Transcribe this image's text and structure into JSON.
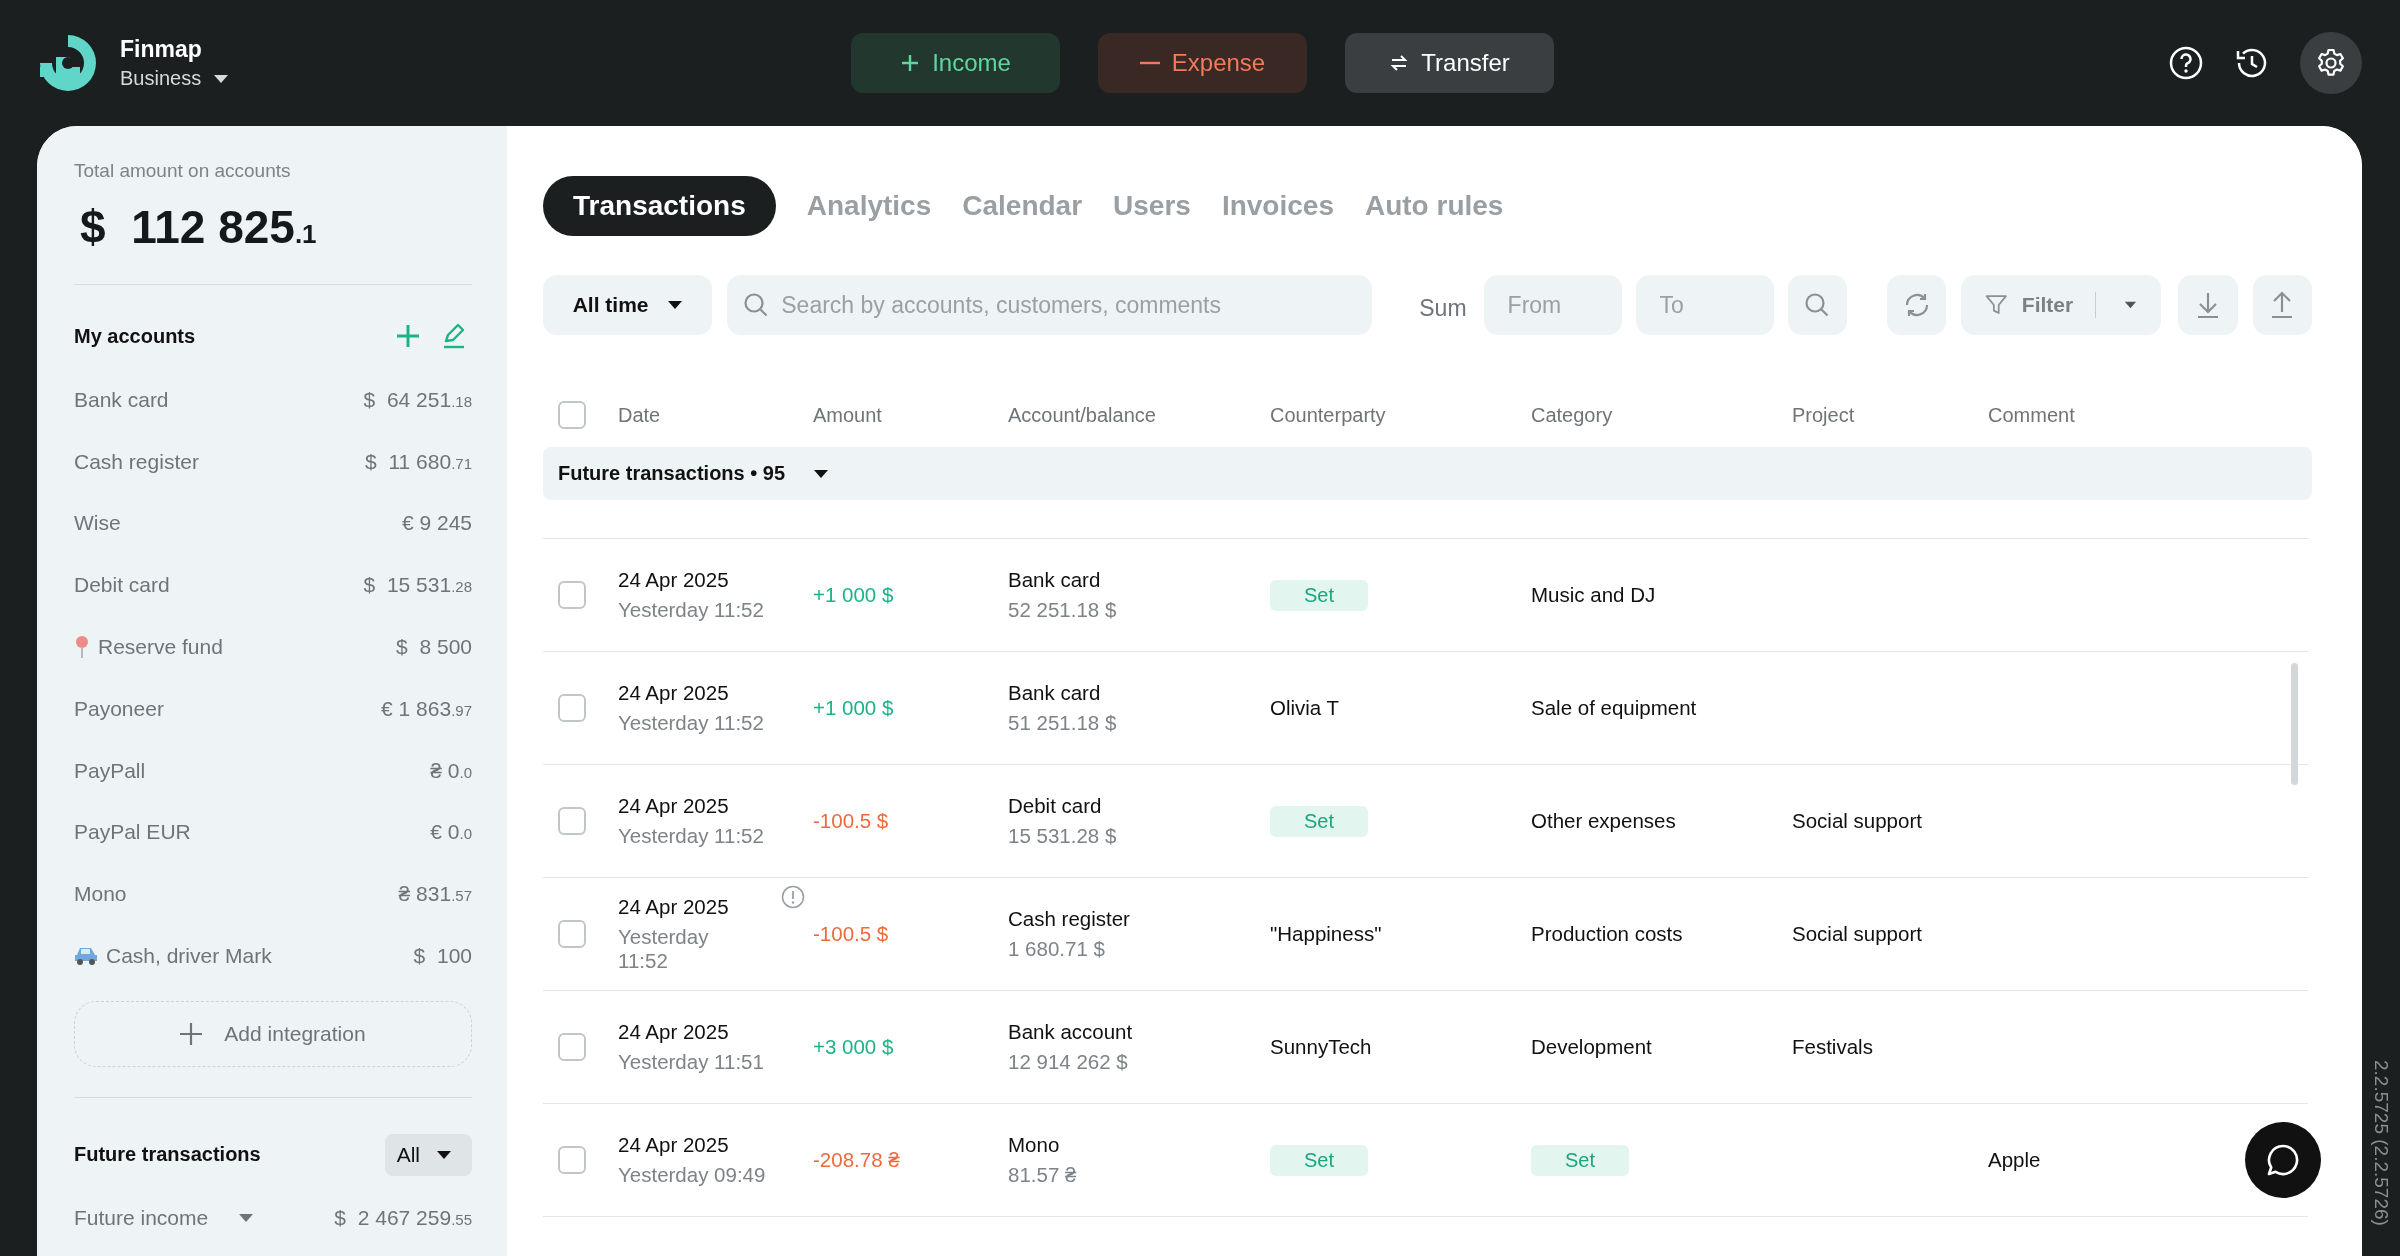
{
  "topbar": {
    "brand": "Finmap",
    "workspace": "Business",
    "actions": [
      {
        "kind": "income",
        "label": "Income"
      },
      {
        "kind": "expense",
        "label": "Expense"
      },
      {
        "kind": "transfer",
        "label": "Transfer"
      }
    ]
  },
  "sidebar": {
    "total_label": "Total amount on accounts",
    "total_amount": "$  112 825",
    "total_cents": ".1",
    "accounts_title": "My accounts",
    "accounts": [
      {
        "kind": "plain",
        "name": "Bank card",
        "amount": "$  64 251",
        "cents": ".18"
      },
      {
        "kind": "plain",
        "name": "Cash register",
        "amount": "$  11 680",
        "cents": ".71"
      },
      {
        "kind": "plain",
        "name": "Wise",
        "amount": "€ 9 245"
      },
      {
        "kind": "plain",
        "name": "Debit card",
        "amount": "$  15 531",
        "cents": ".28"
      },
      {
        "kind": "pin",
        "name": "Reserve fund",
        "amount": "$  8 500"
      },
      {
        "kind": "plain",
        "name": "Payoneer",
        "amount": "€ 1 863",
        "cents": ".97"
      },
      {
        "kind": "plain",
        "name": "PayPall",
        "amount": "₴ 0",
        "cents": ".0"
      },
      {
        "kind": "plain",
        "name": "PayPal EUR",
        "amount": "€ 0",
        "cents": ".0"
      },
      {
        "kind": "plain",
        "name": "Mono",
        "amount": "₴ 831",
        "cents": ".57"
      },
      {
        "kind": "car",
        "name": "Cash, driver Mark",
        "amount": "$  100"
      }
    ],
    "add_integration": "Add integration",
    "future_title": "Future transactions",
    "future_filter": "All",
    "future_income": {
      "label": "Future income",
      "amount": "$  2 467 259",
      "cents": ".55"
    }
  },
  "tabs": [
    {
      "label": "Transactions",
      "selected": true
    },
    {
      "label": "Analytics",
      "selected": false
    },
    {
      "label": "Calendar",
      "selected": false
    },
    {
      "label": "Users",
      "selected": false
    },
    {
      "label": "Invoices",
      "selected": false
    },
    {
      "label": "Auto rules",
      "selected": false
    }
  ],
  "toolbar": {
    "period": "All time",
    "search_placeholder": "Search by accounts, customers, comments",
    "sum_label": "Sum",
    "from_placeholder": "From",
    "to_placeholder": "To",
    "filter_label": "Filter"
  },
  "table": {
    "all_checked": false,
    "columns": [
      "Date",
      "Amount",
      "Account/balance",
      "Counterparty",
      "Category",
      "Project",
      "Comment"
    ],
    "group": {
      "label": "Future transactions • 95",
      "expanded": true
    },
    "rows": [
      {
        "checked": false,
        "date": "24 Apr 2025",
        "time": "Yesterday 11:52",
        "warning": false,
        "kind": "income",
        "amount": "+1 000  $",
        "account": "Bank card",
        "balance": "52 251.18  $",
        "counterparty": {
          "kind": "tag",
          "text": "Set"
        },
        "category": {
          "kind": "text",
          "text": "Music and DJ"
        }
      },
      {
        "checked": false,
        "date": "24 Apr 2025",
        "time": "Yesterday 11:52",
        "warning": false,
        "kind": "income",
        "amount": "+1 000  $",
        "account": "Bank card",
        "balance": "51 251.18  $",
        "counterparty": {
          "kind": "text",
          "text": "Olivia T"
        },
        "category": {
          "kind": "text",
          "text": "Sale of equipment"
        }
      },
      {
        "checked": false,
        "date": "24 Apr 2025",
        "time": "Yesterday 11:52",
        "warning": false,
        "kind": "expense",
        "amount": "-100.5  $",
        "account": "Debit card",
        "balance": "15 531.28  $",
        "counterparty": {
          "kind": "tag",
          "text": "Set"
        },
        "category": {
          "kind": "text",
          "text": "Other expenses"
        },
        "project": "Social support"
      },
      {
        "checked": false,
        "date": "24 Apr 2025",
        "time": "Yesterday 11:52",
        "warning": true,
        "kind": "expense",
        "amount": "-100.5  $",
        "account": "Cash register",
        "balance": "1 680.71  $",
        "counterparty": {
          "kind": "text",
          "text": "\"Happiness\""
        },
        "category": {
          "kind": "text",
          "text": "Production costs"
        },
        "project": "Social support"
      },
      {
        "checked": false,
        "date": "24 Apr 2025",
        "time": "Yesterday 11:51",
        "warning": false,
        "kind": "income",
        "amount": "+3 000  $",
        "account": "Bank account",
        "balance": "12 914 262  $",
        "counterparty": {
          "kind": "text",
          "text": "SunnyTech"
        },
        "category": {
          "kind": "text",
          "text": "Development"
        },
        "project": "Festivals"
      },
      {
        "checked": false,
        "date": "24 Apr 2025",
        "time": "Yesterday 09:49",
        "warning": false,
        "kind": "expense",
        "amount": "-208.78 ₴",
        "account": "Mono",
        "balance": "81.57 ₴",
        "counterparty": {
          "kind": "tag",
          "text": "Set"
        },
        "category": {
          "kind": "tag",
          "text": "Set"
        },
        "comment": "Apple"
      }
    ]
  },
  "version": "2.2.5725 (2.2.5726)"
}
